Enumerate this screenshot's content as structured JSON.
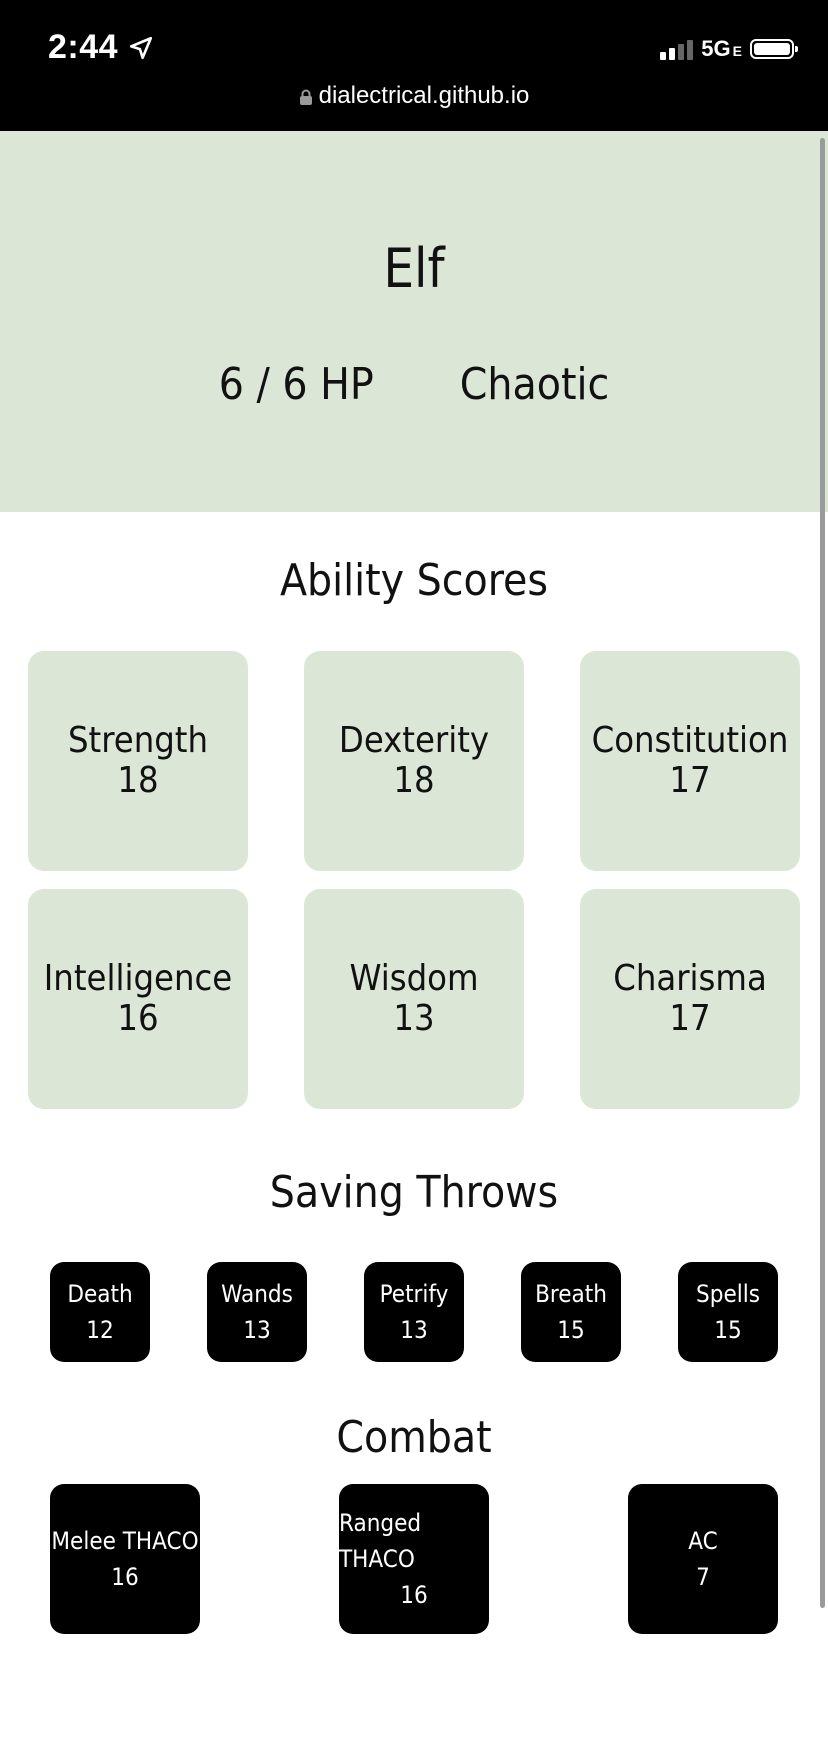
{
  "status_bar": {
    "time": "2:44",
    "network": "5G",
    "network_suffix": "E",
    "url": "dialectrical.github.io"
  },
  "character": {
    "race": "Elf",
    "hp": "6 / 6 HP",
    "alignment": "Chaotic"
  },
  "abilities": {
    "title": "Ability Scores",
    "items": [
      {
        "label": "Strength",
        "value": "18"
      },
      {
        "label": "Dexterity",
        "value": "18"
      },
      {
        "label": "Constitution",
        "value": "17"
      },
      {
        "label": "Intelligence",
        "value": "16"
      },
      {
        "label": "Wisdom",
        "value": "13"
      },
      {
        "label": "Charisma",
        "value": "17"
      }
    ]
  },
  "saving_throws": {
    "title": "Saving Throws",
    "items": [
      {
        "label": "Death",
        "value": "12"
      },
      {
        "label": "Wands",
        "value": "13"
      },
      {
        "label": "Petrify",
        "value": "13"
      },
      {
        "label": "Breath",
        "value": "15"
      },
      {
        "label": "Spells",
        "value": "15"
      }
    ]
  },
  "combat": {
    "title": "Combat",
    "items": [
      {
        "label": "Melee THACO",
        "value": "16"
      },
      {
        "label": "Ranged THACO",
        "value": "16"
      },
      {
        "label": "AC",
        "value": "7"
      }
    ]
  },
  "colors": {
    "panel": "#dce6d6",
    "dark": "#000000"
  }
}
